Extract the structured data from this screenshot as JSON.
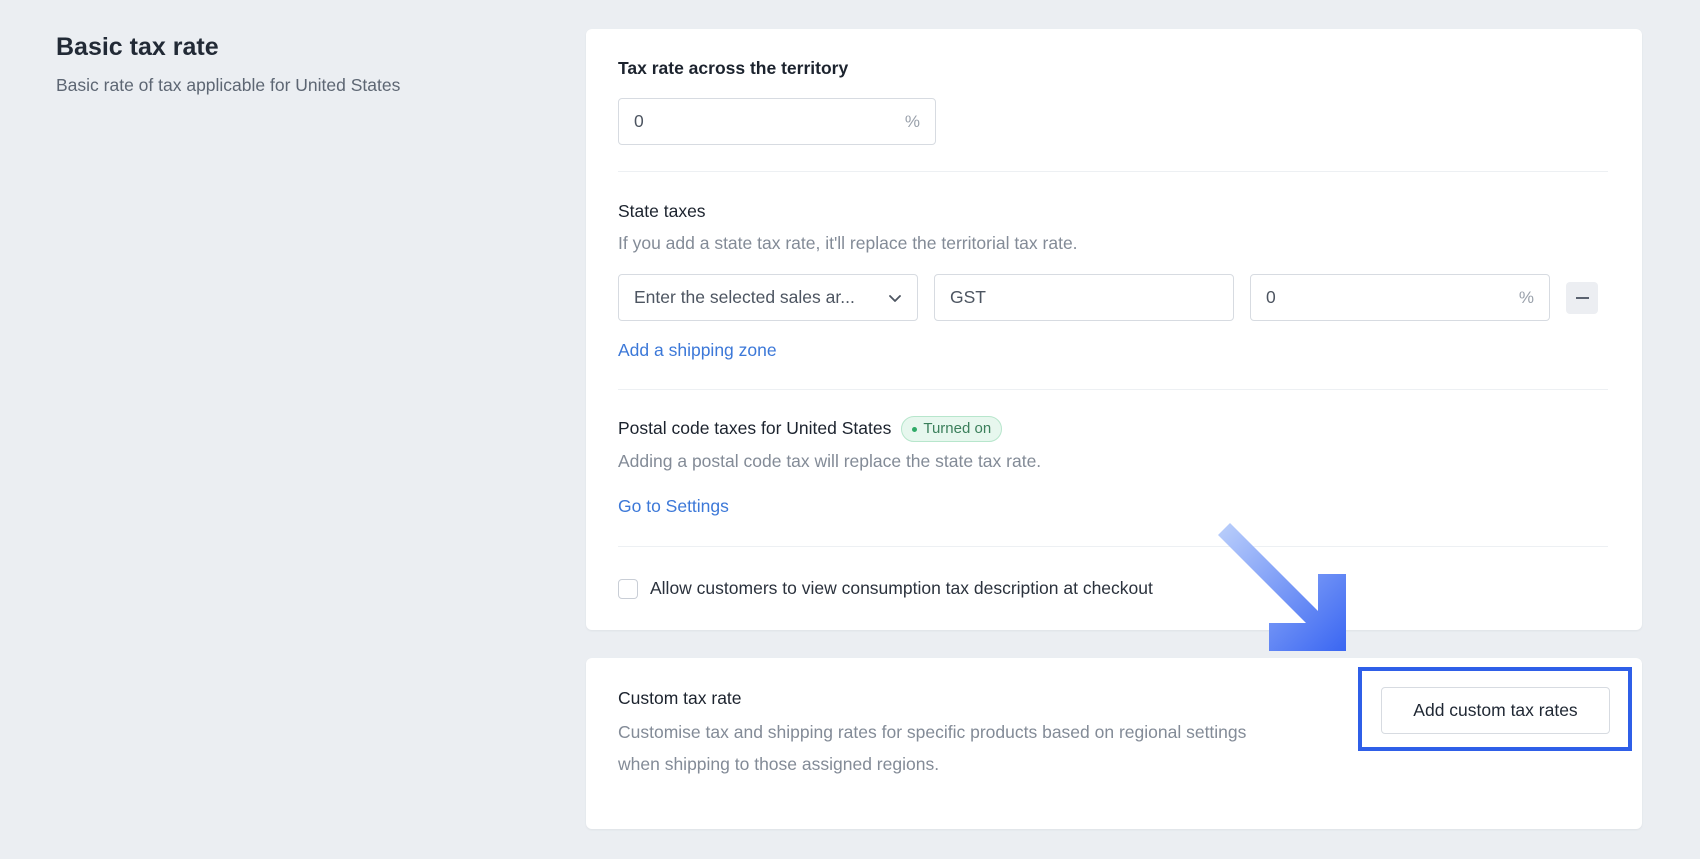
{
  "basic_tax": {
    "title": "Basic tax rate",
    "description": "Basic rate of tax applicable for United States"
  },
  "territory": {
    "label": "Tax rate across the territory",
    "value": "0",
    "suffix": "%"
  },
  "state_taxes": {
    "title": "State taxes",
    "description": "If you add a state tax rate, it'll replace the territorial tax rate.",
    "row": {
      "sales_area_placeholder": "Enter the selected sales ar...",
      "tax_name": "GST",
      "rate": "0",
      "suffix": "%"
    },
    "add_zone_link": "Add a shipping zone"
  },
  "postal_code": {
    "title": "Postal code taxes for United States",
    "badge": "Turned on",
    "description": "Adding a postal code tax will replace the state tax rate.",
    "settings_link": "Go to Settings"
  },
  "checkout_option": {
    "label": "Allow customers to view consumption tax description at checkout",
    "checked": false
  },
  "custom_tax": {
    "title": "Custom tax rate",
    "description_line1": "Customise tax and shipping rates for specific products based on regional settings",
    "description_line2": "when shipping to those assigned regions.",
    "button_label": "Add custom tax rates"
  },
  "colors": {
    "background": "#ebeef2",
    "link": "#3c78d8",
    "badge_bg": "#e7f7ee",
    "badge_text": "#3b7f5b",
    "highlight": "#2f5fe8"
  },
  "icons": {
    "dropdown": "chevron-down-icon",
    "remove": "minus-icon",
    "status": "dot-icon",
    "annotation": "arrow-down-right-icon"
  }
}
